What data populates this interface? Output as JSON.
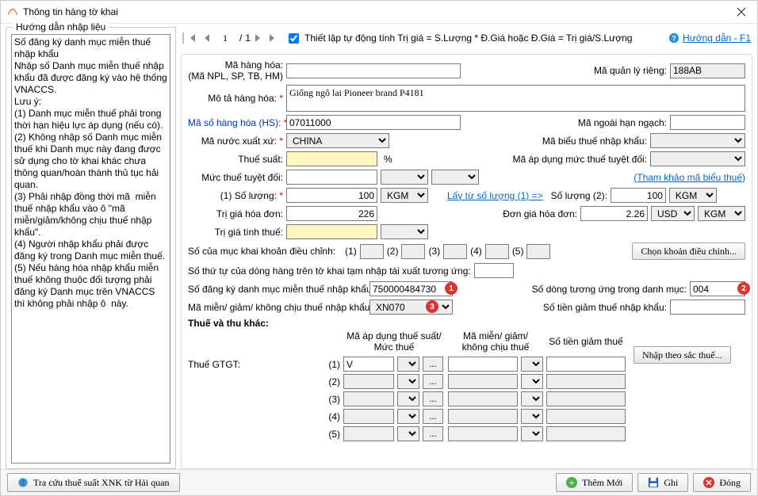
{
  "title": "Thông tin hàng tờ khai",
  "help_link": "Hướng dẫn - F1",
  "left": {
    "heading": "Hướng dẫn nhập liệu",
    "text": "Số đăng ký danh mục miễn thuế nhập khẩu \nNhập số Danh mục miễn thuế nhập khẩu đã được đăng ký vào hệ thống VNACCS.\nLưu ý: \n(1) Danh mục miễn thuế phải trong thời hạn hiệu lực áp dụng (nếu có).\n(2) Không nhập số Danh mục miễn thuế khi Danh mục này đang được sử dụng cho tờ khai khác chưa thông quan/hoàn thành thủ tục hải quan.\n(3) Phải nhập đồng thời mã  miễn thuế nhập khẩu vào ô \"mã miễn/giảm/không chịu thuế nhập khẩu\".\n(4) Người nhập khẩu phải được đăng ký trong Danh mục miễn thuế.\n(5) Nếu hàng hóa nhập khẩu miễn thuế không thuộc đối tượng phải đăng ký Danh mục trên VNACCS thì không phải nhập ô  này."
  },
  "pager": {
    "page": "1",
    "total": "1"
  },
  "checkbox_label": "Thiết lập tự động tính Trị giá = S.Lượng * Đ.Giá hoặc Đ.Giá = Trị giá/S.Lượng",
  "form": {
    "ma_hang_hoa_label": "Mã hàng hóa:",
    "ma_hang_hoa_sub": "(Mã NPL, SP, TB, HM)",
    "ma_quan_ly_rieng_label": "Mã quản lý riêng:",
    "ma_quan_ly_rieng": "188AB",
    "mo_ta_label": "Mô tả hàng hóa:",
    "mo_ta": "Giống ngô lai Pioneer brand P4181",
    "hs_label": "Mã số hàng hóa (HS):",
    "hs": "07011000",
    "ma_ngoai_label": "Mã ngoài hạn ngạch:",
    "ma_nuoc_label": "Mã nước xuất xứ:",
    "ma_nuoc": "CHINA",
    "ma_bieu_label": "Mã biểu thuế nhập khẩu:",
    "thue_suat_label": "Thuế suất:",
    "pct": "%",
    "ma_ap_dung_label": "Mã áp dụng mức thuế tuyệt đối:",
    "muc_thue_label": "Mức thuế tuyệt đối:",
    "tham_khao_link": "(Tham khảo mã biểu thuế)",
    "so_luong1_label": "(1) Số lượng:",
    "so_luong1": "100",
    "unit1": "KGM",
    "lay_tu_link": "Lấy từ số lượng (1)  =>",
    "so_luong2_label": "Số lượng (2):",
    "so_luong2": "100",
    "unit2": "KGM",
    "tri_gia_hd_label": "Trị giá hóa đơn:",
    "tri_gia_hd": "226",
    "don_gia_label": "Đơn giá hóa đơn:",
    "don_gia": "2.26",
    "currency": "USD",
    "unit_price_unit": "KGM",
    "tri_gia_tinh_label": "Trị giá tính thuế:",
    "muc_khoan_label": "Số của mục khai khoản điều chỉnh:",
    "muc_nums": [
      "(1)",
      "(2)",
      "(3)",
      "(4)",
      "(5)"
    ],
    "chon_khoan_btn": "Chọn khoản điều chỉnh...",
    "stt_dong_label": "Số thứ tự của dòng hàng trên tờ khai tạm nhập tái xuất tương ứng:",
    "so_dang_ky_label": "Số đăng ký danh mục miễn thuế nhập khẩu:",
    "so_dang_ky": "750000484730",
    "so_dong_label": "Số dòng tương ứng trong danh mục:",
    "so_dong": "004",
    "ma_mien_label": "Mã miễn/ giảm/ không chịu thuế nhập khẩu:",
    "ma_mien": "XN070",
    "so_tien_giam_label": "Số tiền giảm thuế nhập khẩu:",
    "section_tax": "Thuế và thu khác:",
    "hdr_ma_ap_dung": "Mã áp dụng thuế suất/\nMức thuế",
    "hdr_ma_mien": "Mã miễn/ giảm/\nkhông chịu thuế",
    "hdr_so_tien": "Số tiền giảm thuế",
    "thue_gtgt_label": "Thuế GTGT:",
    "tax_rows": [
      "(1)",
      "(2)",
      "(3)",
      "(4)",
      "(5)"
    ],
    "gtgt_value": "V",
    "nhap_theo_btn": "Nhập theo sắc thuế..."
  },
  "markers": {
    "m1": "1",
    "m2": "2",
    "m3": "3"
  },
  "footer": {
    "left_btn": "Tra cứu thuế suất XNK từ Hải quan",
    "add": "Thêm Mới",
    "save": "Ghi",
    "close": "Đóng"
  }
}
